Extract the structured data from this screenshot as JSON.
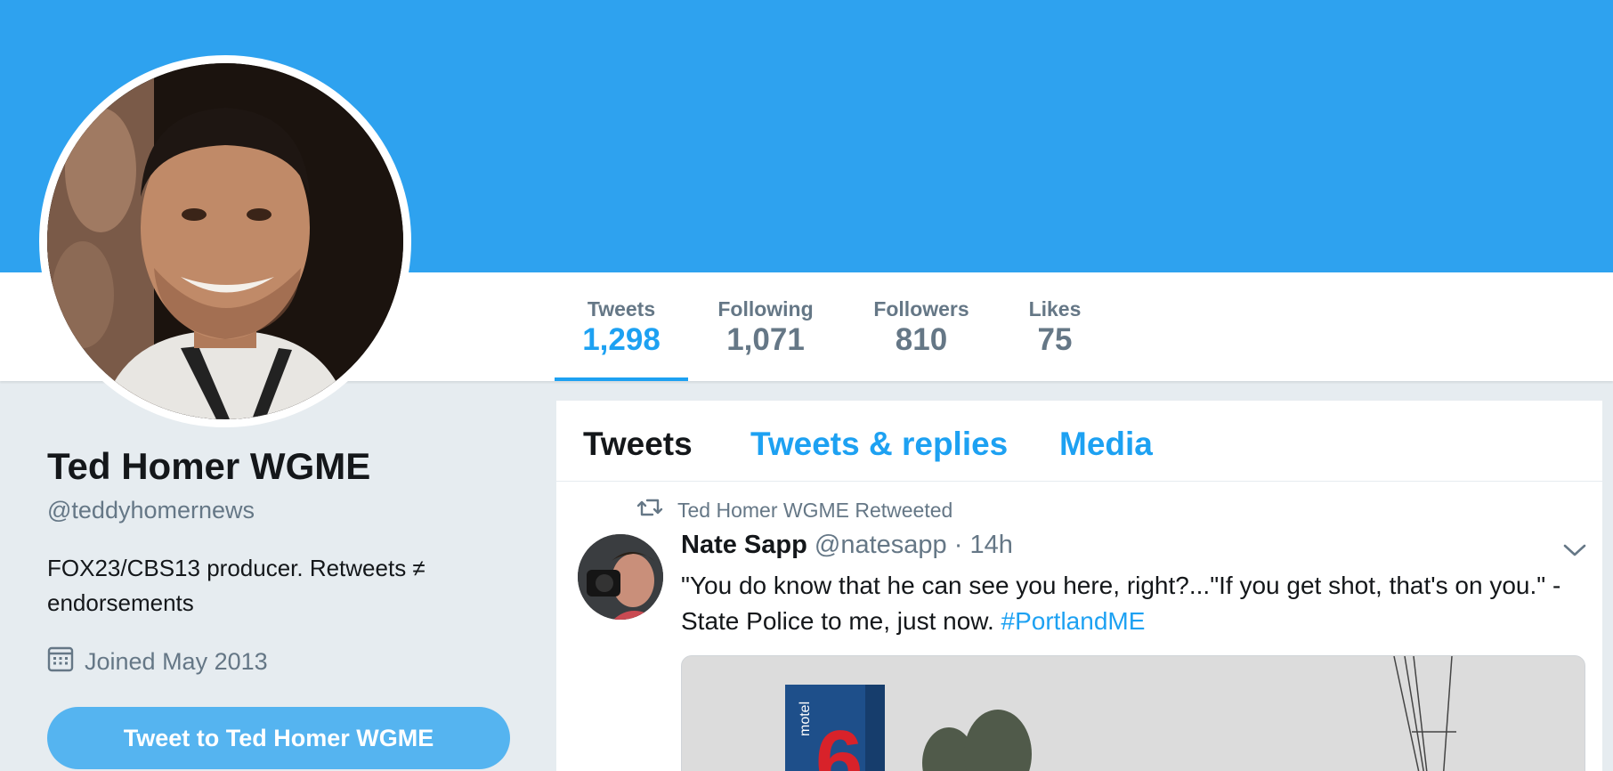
{
  "profile": {
    "name": "Ted Homer WGME",
    "handle": "@teddyhomernews",
    "bio": "FOX23/CBS13 producer. Retweets ≠ endorsements",
    "joined": "Joined May 2013",
    "tweet_to_label": "Tweet to Ted Homer WGME",
    "avatar_icon": "profile-photo"
  },
  "stats": [
    {
      "label": "Tweets",
      "value": "1,298",
      "active": true
    },
    {
      "label": "Following",
      "value": "1,071",
      "active": false
    },
    {
      "label": "Followers",
      "value": "810",
      "active": false
    },
    {
      "label": "Likes",
      "value": "75",
      "active": false
    }
  ],
  "tabs": [
    {
      "label": "Tweets",
      "active": true
    },
    {
      "label": "Tweets & replies",
      "active": false
    },
    {
      "label": "Media",
      "active": false
    }
  ],
  "tweet": {
    "retweeted_by": "Ted Homer WGME Retweeted",
    "author_name": "Nate Sapp",
    "author_handle": "@natesapp",
    "separator": "·",
    "time": "14h",
    "text": "\"You do know that he can see you here, right?...\"If you get shot, that's on you.\" - State Police to me, just now.",
    "hashtag": "#PortlandME",
    "media_sign_text": "motel",
    "media_sign_number": "6"
  },
  "colors": {
    "banner": "#2ea2ef",
    "accent": "#1da1f2",
    "button": "#55b4f0",
    "muted": "#657786",
    "text": "#14171a",
    "page_bg": "#e6ecf0"
  }
}
